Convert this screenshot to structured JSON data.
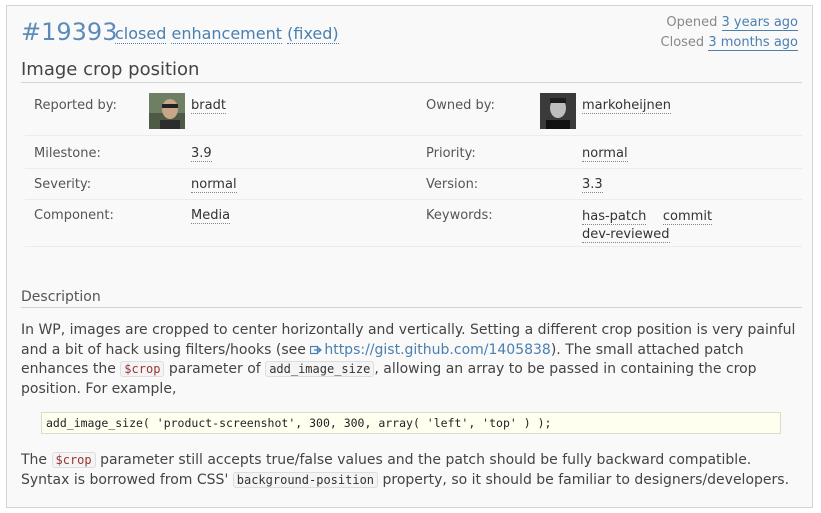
{
  "ticket": {
    "id": "#19393",
    "status": "closed",
    "type": "enhancement",
    "resolution": "(fixed)",
    "title": "Image crop position",
    "opened_label": "Opened",
    "opened_ago": "3 years ago",
    "closed_label": "Closed",
    "closed_ago": "3 months ago"
  },
  "properties": {
    "reported_by_label": "Reported by:",
    "reporter": "bradt",
    "owned_by_label": "Owned by:",
    "owner": "markoheijnen",
    "milestone_label": "Milestone:",
    "milestone": "3.9",
    "priority_label": "Priority:",
    "priority": "normal",
    "severity_label": "Severity:",
    "severity": "normal",
    "version_label": "Version:",
    "version": "3.3",
    "component_label": "Component:",
    "component": "Media",
    "keywords_label": "Keywords:",
    "keywords": [
      "has-patch",
      "commit",
      "dev-reviewed"
    ]
  },
  "description": {
    "heading": "Description",
    "p1_a": "In WP, images are cropped to center horizontally and vertically. Setting a different crop position is very painful and a bit of hack using filters/hooks (see ",
    "p1_link": "https://gist.github.com/1405838",
    "p1_b": "). The small attached patch enhances the ",
    "p1_code1": "$crop",
    "p1_c": " parameter of ",
    "p1_code2": "add_image_size",
    "p1_d": ", allowing an array to be passed in containing the crop position. For example,",
    "code_block": "add_image_size( 'product-screenshot', 300, 300, array( 'left', 'top' ) );",
    "p2_a": "The ",
    "p2_code1": "$crop",
    "p2_b": " parameter still accepts true/false values and the patch should be fully backward compatible. Syntax is borrowed from CSS' ",
    "p2_code2": "background-position",
    "p2_c": " property, so it should be familiar to designers/developers."
  },
  "icons": {
    "external_link": "external-link-icon",
    "reporter_avatar": "avatar",
    "owner_avatar": "avatar"
  },
  "colors": {
    "link": "#4a7fb0",
    "ticket_id": "#5b8bb8",
    "code_red": "#993333"
  }
}
